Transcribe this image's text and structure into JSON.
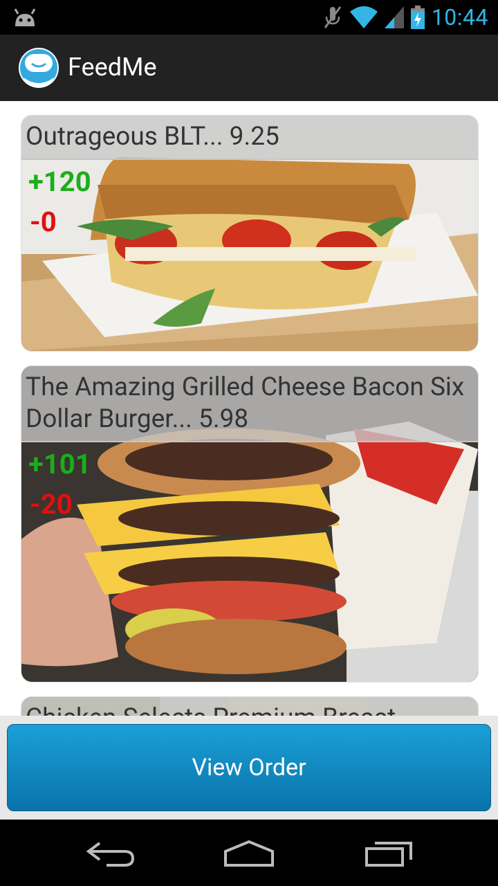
{
  "status_bar": {
    "time": "10:44"
  },
  "app": {
    "title": "FeedMe"
  },
  "items": [
    {
      "name_price": "Outrageous BLT... 9.25",
      "upvotes": "+120",
      "downvotes": "-0"
    },
    {
      "name_price": "The Amazing Grilled Cheese Bacon Six Dollar Burger... 5.98",
      "upvotes": "+101",
      "downvotes": "-20"
    },
    {
      "name_price": "Chicken Selects Premium Breast"
    }
  ],
  "footer": {
    "view_order_label": "View Order"
  }
}
